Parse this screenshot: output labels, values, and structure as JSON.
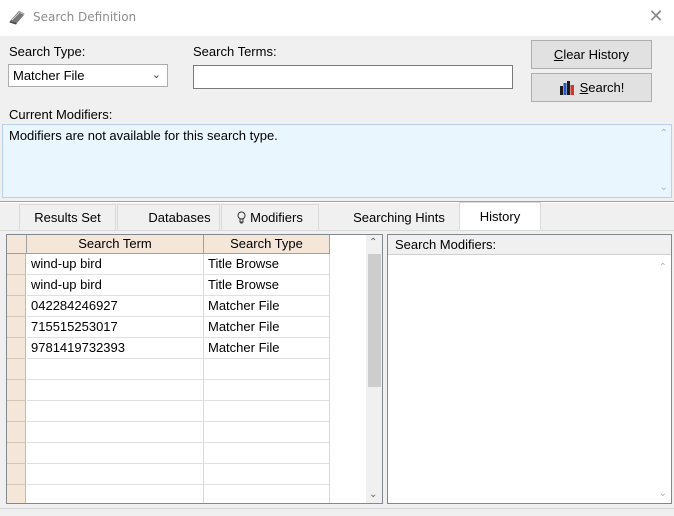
{
  "window": {
    "title": "Search Definition",
    "close_glyph": "✕"
  },
  "search": {
    "type_label": "Search Type:",
    "type_value": "Matcher File",
    "terms_label": "Search Terms:",
    "terms_value": "",
    "clear_history": "Clear History",
    "search_button": "Search!"
  },
  "modifiers": {
    "label": "Current Modifiers:",
    "message": "Modifiers are not available for this search type."
  },
  "tabs": [
    {
      "label": "Results Set",
      "active": false
    },
    {
      "label": "Databases",
      "active": false
    },
    {
      "label": "Modifiers",
      "active": false,
      "icon": "lightbulb-icon"
    },
    {
      "label": "Searching Hints",
      "active": false
    },
    {
      "label": "History",
      "active": true
    }
  ],
  "history_table": {
    "columns": [
      "Search Term",
      "Search Type"
    ],
    "rows": [
      [
        "wind-up bird",
        "Title Browse"
      ],
      [
        "wind-up bird",
        "Title Browse"
      ],
      [
        "042284246927",
        "Matcher File"
      ],
      [
        "715515253017",
        "Matcher File"
      ],
      [
        "9781419732393",
        "Matcher File"
      ]
    ]
  },
  "right_panel": {
    "header": "Search Modifiers:"
  },
  "colors": {
    "header_bg": "#f4e6d8",
    "modifier_bg": "#eaf6fd"
  }
}
